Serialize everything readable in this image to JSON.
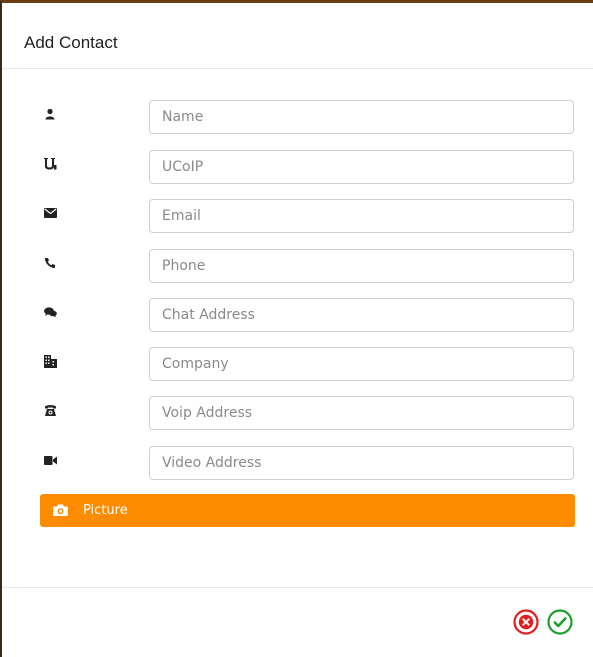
{
  "dialog": {
    "title": "Add Contact"
  },
  "fields": [
    {
      "icon": "user-icon",
      "placeholder": "Name",
      "value": ""
    },
    {
      "icon": "ucoip-icon",
      "placeholder": "UCoIP",
      "value": ""
    },
    {
      "icon": "envelope-icon",
      "placeholder": "Email",
      "value": ""
    },
    {
      "icon": "phone-icon",
      "placeholder": "Phone",
      "value": ""
    },
    {
      "icon": "chat-icon",
      "placeholder": "Chat Address",
      "value": ""
    },
    {
      "icon": "building-icon",
      "placeholder": "Company",
      "value": ""
    },
    {
      "icon": "voip-phone-icon",
      "placeholder": "Voip Address",
      "value": ""
    },
    {
      "icon": "video-camera-icon",
      "placeholder": "Video Address",
      "value": ""
    }
  ],
  "picture_button": {
    "label": "Picture",
    "icon": "camera-icon",
    "color": "#ff8c00"
  },
  "footer": {
    "cancel": {
      "icon": "cancel-circle-icon",
      "color": "#e01e1e"
    },
    "confirm": {
      "icon": "check-circle-icon",
      "color": "#1e9e2e"
    }
  }
}
